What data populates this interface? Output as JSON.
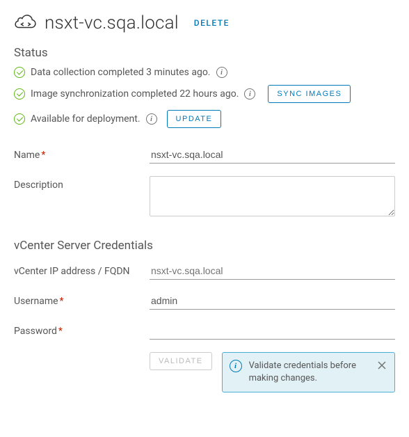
{
  "header": {
    "title": "nsxt-vc.sqa.local",
    "delete_label": "DELETE"
  },
  "status": {
    "section_label": "Status",
    "items": [
      {
        "text": "Data collection completed 3 minutes ago."
      },
      {
        "text": "Image synchronization completed 22 hours ago.",
        "action": "SYNC IMAGES"
      },
      {
        "text": "Available for deployment.",
        "action": "UPDATE"
      }
    ]
  },
  "form": {
    "name_label": "Name",
    "name_value": "nsxt-vc.sqa.local",
    "description_label": "Description",
    "description_value": ""
  },
  "credentials": {
    "section_label": "vCenter Server Credentials",
    "ip_label": "vCenter IP address / FQDN",
    "ip_value": "nsxt-vc.sqa.local",
    "username_label": "Username",
    "username_value": "admin",
    "password_label": "Password",
    "password_value": "",
    "validate_label": "VALIDATE",
    "alert_text": "Validate credentials before making changes."
  }
}
